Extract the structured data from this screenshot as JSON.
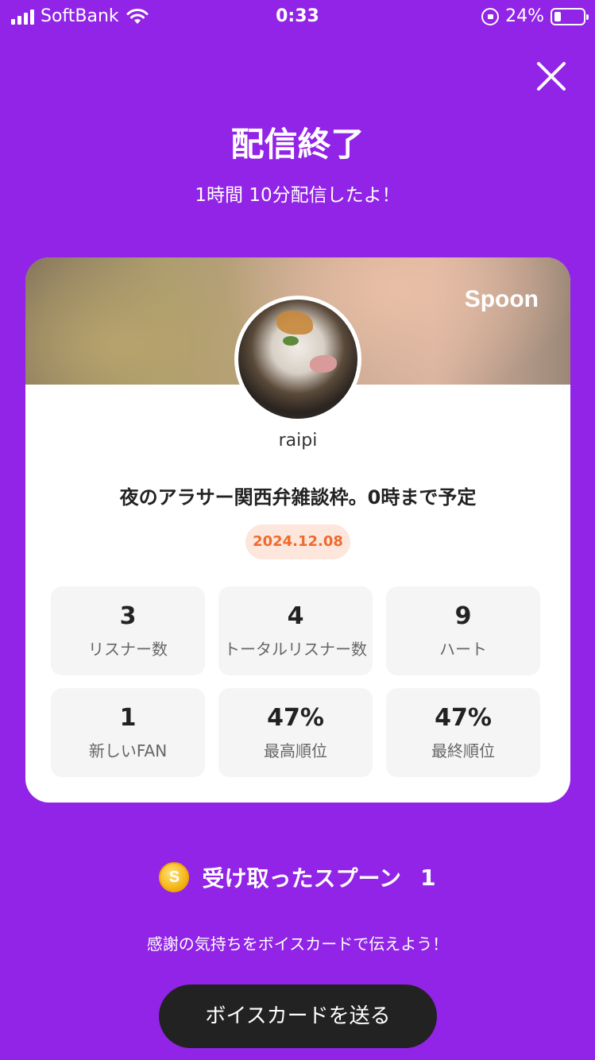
{
  "status_bar": {
    "carrier": "SoftBank",
    "time": "0:33",
    "battery_percent": "24%",
    "battery_level": 0.24
  },
  "header": {
    "title": "配信終了",
    "subtitle": "1時間 10分配信したよ！"
  },
  "card": {
    "brand": "Spoon",
    "username": "raipi",
    "live_title": "夜のアラサー関西弁雑談枠。0時まで予定",
    "date": "2024.12.08",
    "stats": [
      {
        "value": "3",
        "label": "リスナー数"
      },
      {
        "value": "4",
        "label": "トータルリスナー数"
      },
      {
        "value": "9",
        "label": "ハート"
      },
      {
        "value": "1",
        "label": "新しいFAN"
      },
      {
        "value": "47%",
        "label": "最高順位"
      },
      {
        "value": "47%",
        "label": "最終順位"
      }
    ]
  },
  "spoons": {
    "label": "受け取ったスプーン",
    "count": "1",
    "icon": "coin-icon"
  },
  "footer": {
    "thanks_text": "感謝の気持ちをボイスカードで伝えよう！",
    "voice_card_button": "ボイスカードを送る"
  },
  "colors": {
    "background": "#9124e6",
    "date_badge_text": "#f06a2c",
    "date_badge_bg": "#fde6dc",
    "button_bg": "#222222"
  }
}
